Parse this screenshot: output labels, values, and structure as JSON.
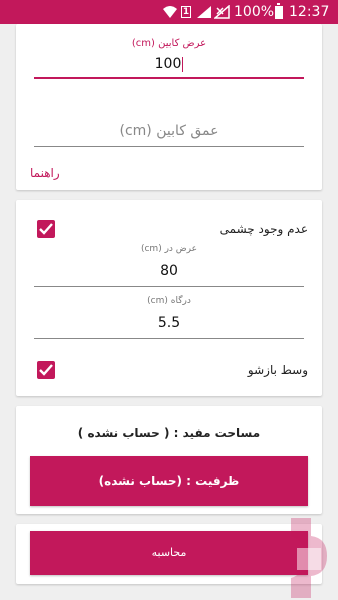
{
  "status_bar": {
    "battery_percent": "100%",
    "time": "12:37",
    "sim_label": "1",
    "icons": [
      "wifi-icon",
      "sim-icon",
      "signal-icon",
      "no-signal-icon",
      "battery-icon"
    ]
  },
  "cabinet": {
    "width_label": "عرض کابین (cm)",
    "width_value": "100",
    "depth_placeholder": "عمق کابین (cm)",
    "guide_link": "راهنما"
  },
  "options": {
    "no_eye_label": "عدم وجود چشمی",
    "no_eye_checked": true,
    "width_label": "عرض در (cm)",
    "width_value": "80",
    "door_label": "(cm) درگاه",
    "door_value": "5.5",
    "center_label": "وسط بازشو",
    "center_checked": true
  },
  "results": {
    "area_label": "مساحت مفید : ( حساب نشده )",
    "capacity_label": "ظرفیت : (حساب نشده)"
  },
  "actions": {
    "calculate_label": "محاسبه"
  },
  "colors": {
    "accent": "#c2185b",
    "status_bar": "#c2185b",
    "background": "#efefef",
    "card": "#ffffff"
  }
}
